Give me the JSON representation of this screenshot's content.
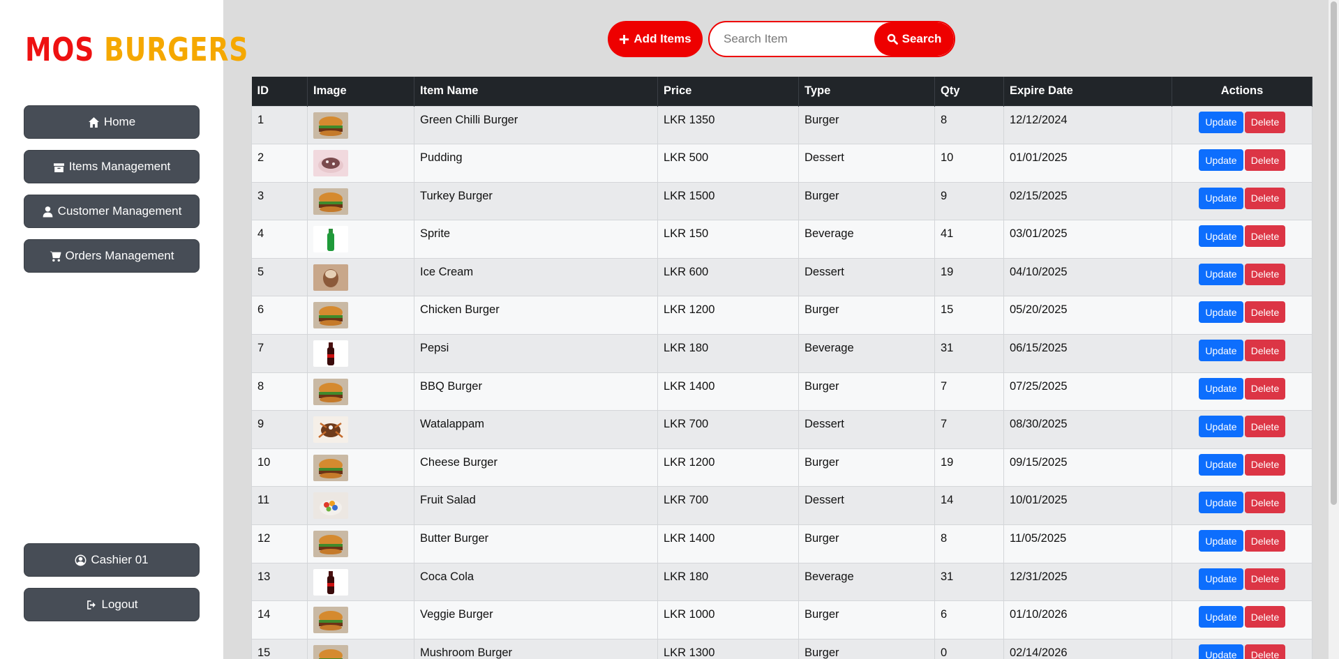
{
  "logo": {
    "part1": "MOS",
    "part2": "BURGERS"
  },
  "sidebar": {
    "nav": [
      {
        "label": "Home",
        "icon": "home-icon"
      },
      {
        "label": "Items Management",
        "icon": "box-icon"
      },
      {
        "label": "Customer Management",
        "icon": "user-icon"
      },
      {
        "label": "Orders Management",
        "icon": "cart-icon"
      }
    ],
    "user": {
      "label": "Cashier 01",
      "icon": "user-circle-icon"
    },
    "logout": {
      "label": "Logout",
      "icon": "logout-icon"
    }
  },
  "toolbar": {
    "add_label": "Add Items",
    "search_placeholder": "Search Item",
    "search_value": "",
    "search_label": "Search"
  },
  "colors": {
    "accent": "#ee0000",
    "logo_yellow": "#f5a800",
    "update": "#0d6efd",
    "delete": "#dc3545",
    "header": "#212529"
  },
  "table": {
    "headers": [
      "ID",
      "Image",
      "Item Name",
      "Price",
      "Type",
      "Qty",
      "Expire Date",
      "Actions"
    ],
    "update_label": "Update",
    "delete_label": "Delete",
    "rows": [
      {
        "id": "1",
        "name": "Green Chilli Burger",
        "price": "LKR 1350",
        "type": "Burger",
        "qty": "8",
        "expire": "12/12/2024",
        "thumb": "burger"
      },
      {
        "id": "2",
        "name": "Pudding",
        "price": "LKR 500",
        "type": "Dessert",
        "qty": "10",
        "expire": "01/01/2025",
        "thumb": "pudding"
      },
      {
        "id": "3",
        "name": "Turkey Burger",
        "price": "LKR 1500",
        "type": "Burger",
        "qty": "9",
        "expire": "02/15/2025",
        "thumb": "burger"
      },
      {
        "id": "4",
        "name": "Sprite",
        "price": "LKR 150",
        "type": "Beverage",
        "qty": "41",
        "expire": "03/01/2025",
        "thumb": "sprite"
      },
      {
        "id": "5",
        "name": "Ice Cream",
        "price": "LKR 600",
        "type": "Dessert",
        "qty": "19",
        "expire": "04/10/2025",
        "thumb": "icecream"
      },
      {
        "id": "6",
        "name": "Chicken Burger",
        "price": "LKR 1200",
        "type": "Burger",
        "qty": "15",
        "expire": "05/20/2025",
        "thumb": "burger"
      },
      {
        "id": "7",
        "name": "Pepsi",
        "price": "LKR 180",
        "type": "Beverage",
        "qty": "31",
        "expire": "06/15/2025",
        "thumb": "cola"
      },
      {
        "id": "8",
        "name": "BBQ Burger",
        "price": "LKR 1400",
        "type": "Burger",
        "qty": "7",
        "expire": "07/25/2025",
        "thumb": "burger"
      },
      {
        "id": "9",
        "name": "Watalappam",
        "price": "LKR 700",
        "type": "Dessert",
        "qty": "7",
        "expire": "08/30/2025",
        "thumb": "watalappam"
      },
      {
        "id": "10",
        "name": "Cheese Burger",
        "price": "LKR 1200",
        "type": "Burger",
        "qty": "19",
        "expire": "09/15/2025",
        "thumb": "burger"
      },
      {
        "id": "11",
        "name": "Fruit Salad",
        "price": "LKR 700",
        "type": "Dessert",
        "qty": "14",
        "expire": "10/01/2025",
        "thumb": "fruit"
      },
      {
        "id": "12",
        "name": "Butter Burger",
        "price": "LKR 1400",
        "type": "Burger",
        "qty": "8",
        "expire": "11/05/2025",
        "thumb": "burger"
      },
      {
        "id": "13",
        "name": "Coca Cola",
        "price": "LKR 180",
        "type": "Beverage",
        "qty": "31",
        "expire": "12/31/2025",
        "thumb": "cola"
      },
      {
        "id": "14",
        "name": "Veggie Burger",
        "price": "LKR 1000",
        "type": "Burger",
        "qty": "6",
        "expire": "01/10/2026",
        "thumb": "burger"
      },
      {
        "id": "15",
        "name": "Mushroom Burger",
        "price": "LKR 1300",
        "type": "Burger",
        "qty": "0",
        "expire": "02/14/2026",
        "thumb": "burger"
      }
    ]
  }
}
